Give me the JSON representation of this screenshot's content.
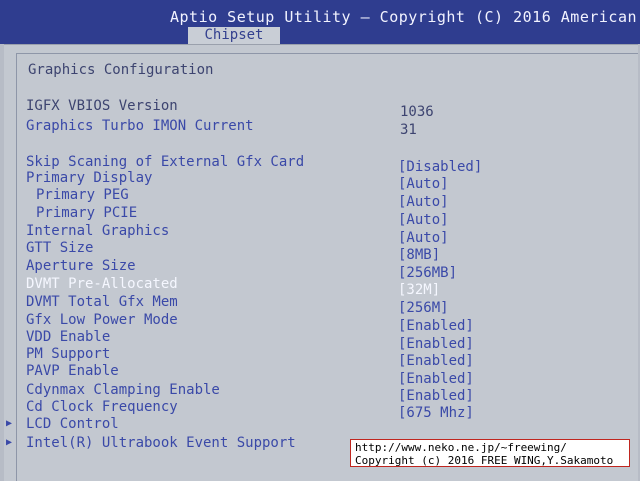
{
  "header": {
    "title": "Aptio Setup Utility – Copyright (C) 2016 American",
    "tab": "Chipset"
  },
  "section_title": "Graphics Configuration",
  "info": [
    {
      "label": "IGFX VBIOS Version",
      "value": "1036"
    },
    {
      "label": "Graphics Turbo IMON Current",
      "value": "31"
    }
  ],
  "settings": [
    {
      "label": "Skip Scaning of External Gfx Card",
      "value": "[Disabled]"
    },
    {
      "label": "Primary Display",
      "value": "[Auto]"
    },
    {
      "label": "Primary PEG",
      "value": "[Auto]"
    },
    {
      "label": "Primary PCIE",
      "value": "[Auto]"
    },
    {
      "label": "Internal Graphics",
      "value": "[Auto]"
    },
    {
      "label": "GTT Size",
      "value": "[8MB]"
    },
    {
      "label": "Aperture Size",
      "value": "[256MB]"
    },
    {
      "label": "DVMT Pre-Allocated",
      "value": "[32M]"
    },
    {
      "label": "DVMT Total Gfx Mem",
      "value": "[256M]"
    },
    {
      "label": "Gfx Low Power Mode",
      "value": "[Enabled]"
    },
    {
      "label": "VDD Enable",
      "value": "[Enabled]"
    },
    {
      "label": "PM Support",
      "value": "[Enabled]"
    },
    {
      "label": "PAVP Enable",
      "value": "[Enabled]"
    },
    {
      "label": "Cdynmax Clamping Enable",
      "value": "[Enabled]"
    },
    {
      "label": "Cd Clock Frequency",
      "value": "[675 Mhz]"
    }
  ],
  "submenus": [
    {
      "label": "LCD Control"
    },
    {
      "label": "Intel(R) Ultrabook Event Support"
    }
  ],
  "watermark": {
    "line1": "http://www.neko.ne.jp/~freewing/",
    "line2": "Copyright (c) 2016 FREE WING,Y.Sakamoto"
  },
  "colors": {
    "header_bg": "#2f3d8f",
    "panel_bg": "#c3c8d0",
    "item_text": "#3a49a8",
    "selected_text": "#f5f7ff"
  }
}
